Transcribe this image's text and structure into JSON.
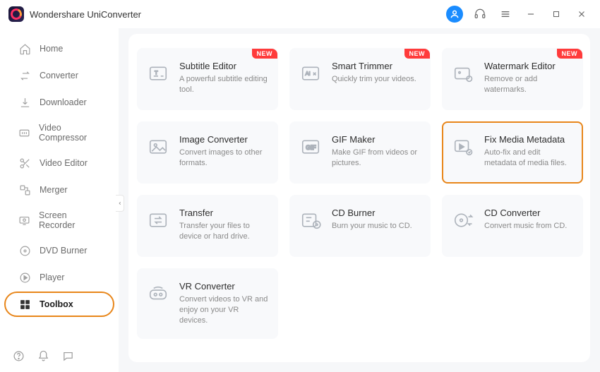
{
  "app": {
    "title": "Wondershare UniConverter"
  },
  "sidebar": {
    "items": [
      {
        "label": "Home"
      },
      {
        "label": "Converter"
      },
      {
        "label": "Downloader"
      },
      {
        "label": "Video Compressor"
      },
      {
        "label": "Video Editor"
      },
      {
        "label": "Merger"
      },
      {
        "label": "Screen Recorder"
      },
      {
        "label": "DVD Burner"
      },
      {
        "label": "Player"
      },
      {
        "label": "Toolbox"
      }
    ]
  },
  "badge_new": "NEW",
  "tools": [
    {
      "title": "Subtitle Editor",
      "desc": "A powerful subtitle editing tool.",
      "new": true
    },
    {
      "title": "Smart Trimmer",
      "desc": "Quickly trim your videos.",
      "new": true
    },
    {
      "title": "Watermark Editor",
      "desc": "Remove or add watermarks.",
      "new": true
    },
    {
      "title": "Image Converter",
      "desc": "Convert images to other formats."
    },
    {
      "title": "GIF Maker",
      "desc": "Make GIF from videos or pictures."
    },
    {
      "title": "Fix Media Metadata",
      "desc": "Auto-fix and edit metadata of media files.",
      "highlight": true
    },
    {
      "title": "Transfer",
      "desc": "Transfer your files to device or hard drive."
    },
    {
      "title": "CD Burner",
      "desc": "Burn your music to CD."
    },
    {
      "title": "CD Converter",
      "desc": "Convert music from CD."
    },
    {
      "title": "VR Converter",
      "desc": "Convert videos to VR and enjoy on your VR devices."
    }
  ]
}
